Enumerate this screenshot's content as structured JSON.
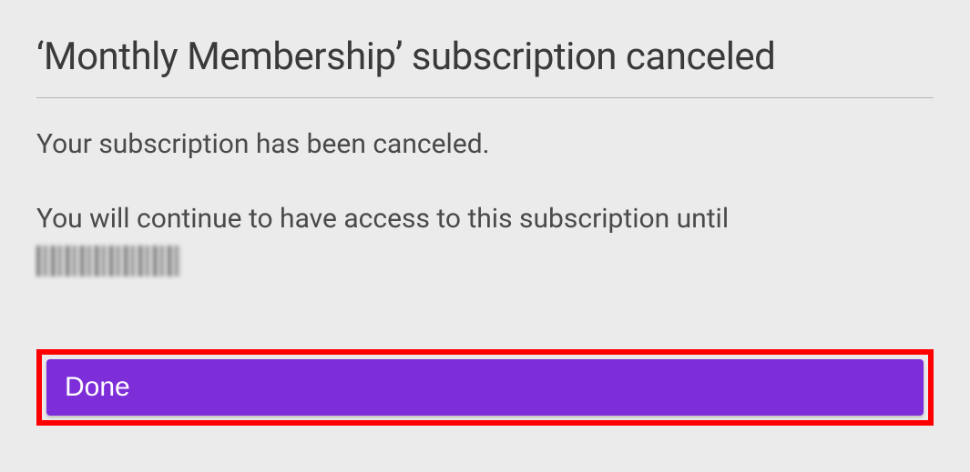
{
  "dialog": {
    "title": "‘Monthly Membership’ subscription canceled",
    "confirmation_message": "Your subscription has been canceled.",
    "access_message": "You will continue to have access to this subscription until",
    "expiry_date_redacted": true,
    "done_button_label": "Done"
  },
  "colors": {
    "background": "#ebebeb",
    "primary_button": "#7d2ed9",
    "highlight_border": "#ff0000",
    "text": "#3a3a3a"
  }
}
